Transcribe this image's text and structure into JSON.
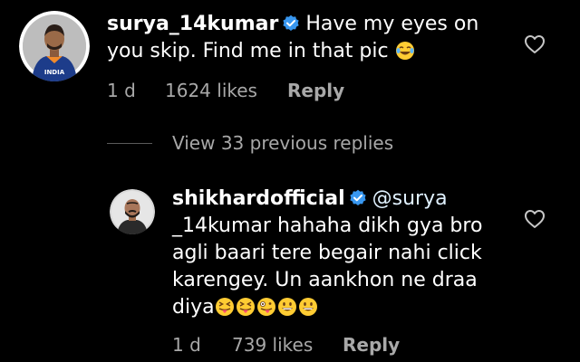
{
  "comments": [
    {
      "username": "surya_14kumar",
      "text": "Have my eyes on you skip. Find me in that pic",
      "text_line1": "Have my eyes on",
      "text_line2": "you skip. Find me in that pic",
      "emoji": [
        "joy-emoji"
      ],
      "time": "1 d",
      "likes": "1624 likes",
      "reply_label": "Reply",
      "verified": true,
      "avatar_jersey_text": "INDIA"
    },
    {
      "username": "shikhardofficial",
      "mention": "@surya",
      "text_line1_suffix": "",
      "text_line2": "_14kumar hahaha dikh gya bro",
      "text_line3": "agli baari tere begair nahi click",
      "text_line4": "karengey. Un aankhon ne draa",
      "text_line5": "diya",
      "emoji": [
        "tongue-squint-emoji",
        "tongue-squint-emoji",
        "zany-emoji",
        "grin-emoji",
        "grin-emoji"
      ],
      "time": "1 d",
      "likes": "739 likes",
      "reply_label": "Reply",
      "verified": true
    }
  ],
  "view_replies": "View 33 previous replies",
  "colors": {
    "background": "#000000",
    "text": "#ffffff",
    "meta": "#a8a8a8",
    "verified": "#3897f0",
    "avatar_ring": "#ffffff"
  }
}
